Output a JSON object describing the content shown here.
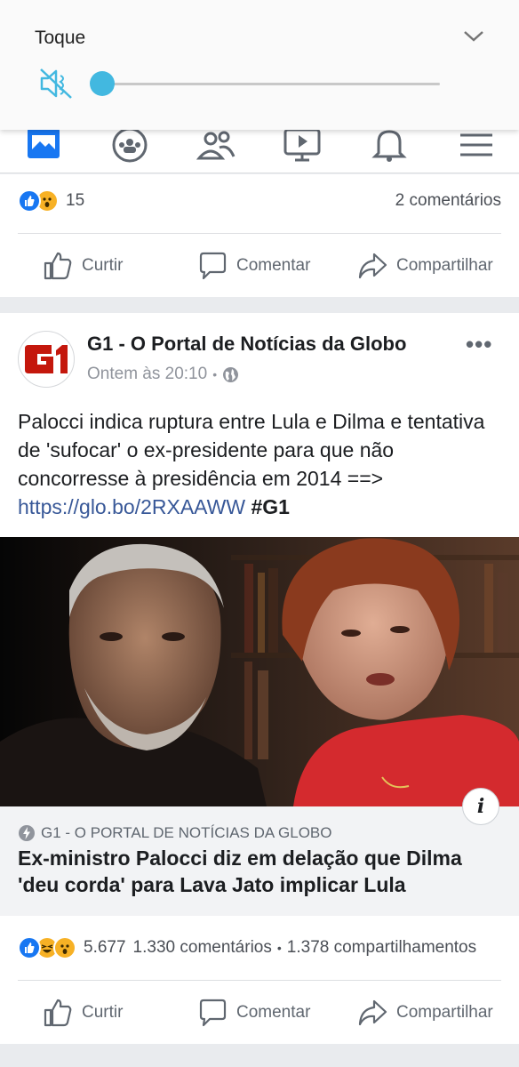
{
  "volume": {
    "label": "Toque",
    "level": 0.0,
    "accent": "#42b8e0",
    "icons": [
      "muted-speaker-icon",
      "chevron-down-icon"
    ]
  },
  "nav": {
    "items": [
      "news-feed-icon",
      "groups-icon",
      "friends-icon",
      "watch-icon",
      "notifications-icon",
      "menu-icon"
    ]
  },
  "post1": {
    "reaction_count": "15",
    "comments": "2 comentários",
    "actions": {
      "like": "Curtir",
      "comment": "Comentar",
      "share": "Compartilhar"
    }
  },
  "post2": {
    "page_name": "G1 - O Portal de Notícias da Globo",
    "time": "Ontem às 20:10",
    "separator": "•",
    "text_main": "Palocci indica ruptura entre Lula e Dilma e tentativa de 'sufocar' o ex-presidente para que não concorresse à presidência em 2014 ==> ",
    "link": "https://glo.bo/2RXAAWW",
    "hashtag": "#G1",
    "link_preview": {
      "domain": "G1 - O PORTAL DE NOTÍCIAS DA GLOBO",
      "title": "Ex-ministro Palocci diz em delação que Dilma 'deu corda' para Lava Jato implicar Lula",
      "info": "i"
    },
    "reaction_count": "5.677",
    "comments": "1.330 comentários",
    "shares": "1.378 compartilhamentos",
    "actions": {
      "like": "Curtir",
      "comment": "Comentar",
      "share": "Compartilhar"
    }
  },
  "colors": {
    "brand": "#1877f2",
    "link": "#385898",
    "g1_red": "#c4170c"
  }
}
